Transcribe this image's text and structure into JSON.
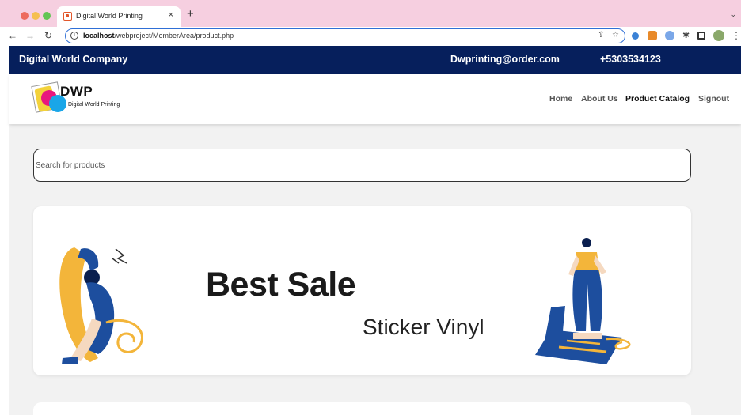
{
  "browser": {
    "tab_title": "Digital World Printing",
    "tab_close": "×",
    "new_tab": "+",
    "tab_menu": "⌄",
    "url_host": "localhost",
    "url_path": "/webproject/MemberArea/product.php"
  },
  "header": {
    "company": "Digital World Company",
    "email": "Dwprinting@order.com",
    "phone": "+5303534123"
  },
  "logo": {
    "mark": "DWP",
    "subtitle": "Digital  World Printing"
  },
  "nav": {
    "items": [
      {
        "label": "Home",
        "active": false
      },
      {
        "label": "About Us",
        "active": false
      },
      {
        "label": "Product Catalog",
        "active": true
      },
      {
        "label": "Signout",
        "active": false
      }
    ]
  },
  "search": {
    "placeholder": "Search for products"
  },
  "banner": {
    "title": "Best Sale",
    "subtitle": "Sticker Vinyl"
  },
  "colors": {
    "topbar": "#061f5c",
    "tabbar": "#f6cfe0",
    "page_bg": "#f2f2f2",
    "accent_blue": "#1d4e9e",
    "accent_yellow": "#f3b53a"
  }
}
